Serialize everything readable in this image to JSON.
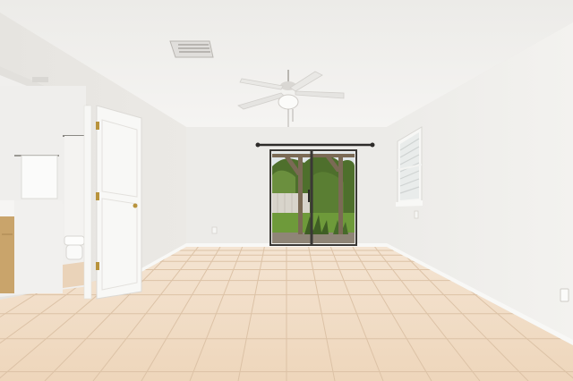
{
  "scene": {
    "kind": "photo",
    "subject": "empty-room",
    "icons": [
      "ceiling-fan-icon",
      "air-vent-icon",
      "curtain-rod-icon",
      "electrical-outlet-icon"
    ],
    "colors": {
      "ceiling": "#f3f2ef",
      "back_wall": "#ecebe8",
      "left_wall": "#e4e2de",
      "right_wall": "#eeedea",
      "floor_tile": "#f1ddc6",
      "grout": "#dcc2a6",
      "door": "#f7f7f5",
      "bathroom_wall": "#efeeec",
      "cabinet": "#c9a46b",
      "grass": "#6e9a3a",
      "foliage": "#4e6f2c",
      "pergola": "#7b6a55",
      "fence": "#d8d4cb",
      "sky": "#dfe6e8"
    }
  }
}
